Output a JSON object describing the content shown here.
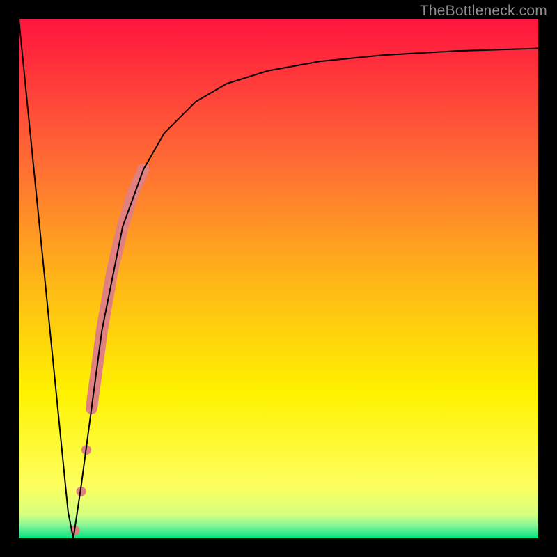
{
  "watermark": "TheBottleneck.com",
  "chart_data": {
    "type": "line",
    "title": "",
    "xlabel": "",
    "ylabel": "",
    "xlim": [
      0,
      100
    ],
    "ylim": [
      0,
      100
    ],
    "grid": false,
    "legend": false,
    "background_gradient": {
      "stops": [
        {
          "pos": 0.0,
          "color": "#ff143f"
        },
        {
          "pos": 0.28,
          "color": "#ff6d34"
        },
        {
          "pos": 0.51,
          "color": "#ffb816"
        },
        {
          "pos": 0.72,
          "color": "#fff200"
        },
        {
          "pos": 0.9,
          "color": "#fdff5f"
        },
        {
          "pos": 0.955,
          "color": "#d4ff7e"
        },
        {
          "pos": 0.975,
          "color": "#88f598"
        },
        {
          "pos": 1.0,
          "color": "#00e47f"
        }
      ]
    },
    "series": [
      {
        "name": "main-curve",
        "color": "#000000",
        "stroke_width": 2,
        "x": [
          0,
          2,
          4,
          6,
          8,
          9.5,
          10.5,
          12,
          14,
          16,
          20,
          24,
          28,
          34,
          40,
          48,
          58,
          70,
          84,
          100
        ],
        "y": [
          100,
          80,
          60,
          40,
          20,
          5,
          0,
          10,
          25,
          40,
          60,
          71,
          78,
          84,
          87.5,
          90,
          91.8,
          93,
          93.8,
          94.3
        ]
      }
    ],
    "thick_segment": {
      "name": "highlight-band",
      "color": "#e08080",
      "stroke_width": 17,
      "x": [
        14,
        16,
        18,
        20,
        22,
        24
      ],
      "y": [
        25,
        40,
        51.5,
        60,
        66.5,
        71
      ]
    },
    "dots": {
      "name": "highlight-dots",
      "color": "#e08080",
      "radius": 7,
      "points": [
        {
          "x": 10.8,
          "y": 1.5
        },
        {
          "x": 12.0,
          "y": 9.0
        },
        {
          "x": 13.0,
          "y": 17.0
        }
      ]
    }
  }
}
